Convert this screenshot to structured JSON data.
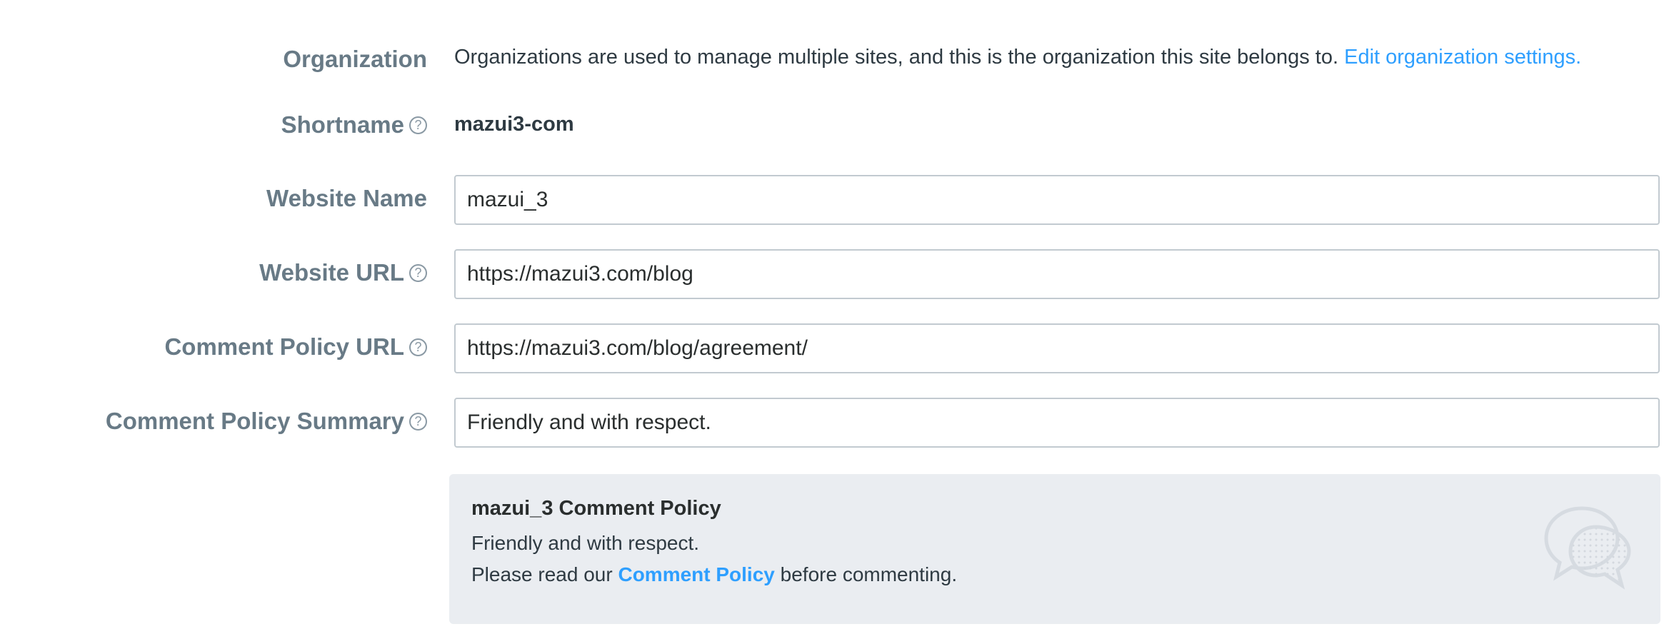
{
  "rows": {
    "organization": {
      "label": "Organization",
      "text": "Organizations are used to manage multiple sites, and this is the organization this site belongs to.",
      "link": "Edit organization settings."
    },
    "shortname": {
      "label": "Shortname",
      "value": "mazui3-com"
    },
    "website_name": {
      "label": "Website Name",
      "value": "mazui_3"
    },
    "website_url": {
      "label": "Website URL",
      "value": "https://mazui3.com/blog"
    },
    "policy_url": {
      "label": "Comment Policy URL",
      "value": "https://mazui3.com/blog/agreement/"
    },
    "policy_summary": {
      "label": "Comment Policy Summary",
      "value": "Friendly and with respect."
    }
  },
  "help_icon_glyph": "?",
  "preview": {
    "title": "mazui_3 Comment Policy",
    "summary": "Friendly and with respect.",
    "prefix": "Please read our",
    "link": "Comment Policy",
    "suffix": "before commenting.",
    "icon": "speech-bubbles-icon"
  },
  "colors": {
    "link": "#2e9fff",
    "label": "#687a86",
    "card_bg": "#eaedf1"
  }
}
